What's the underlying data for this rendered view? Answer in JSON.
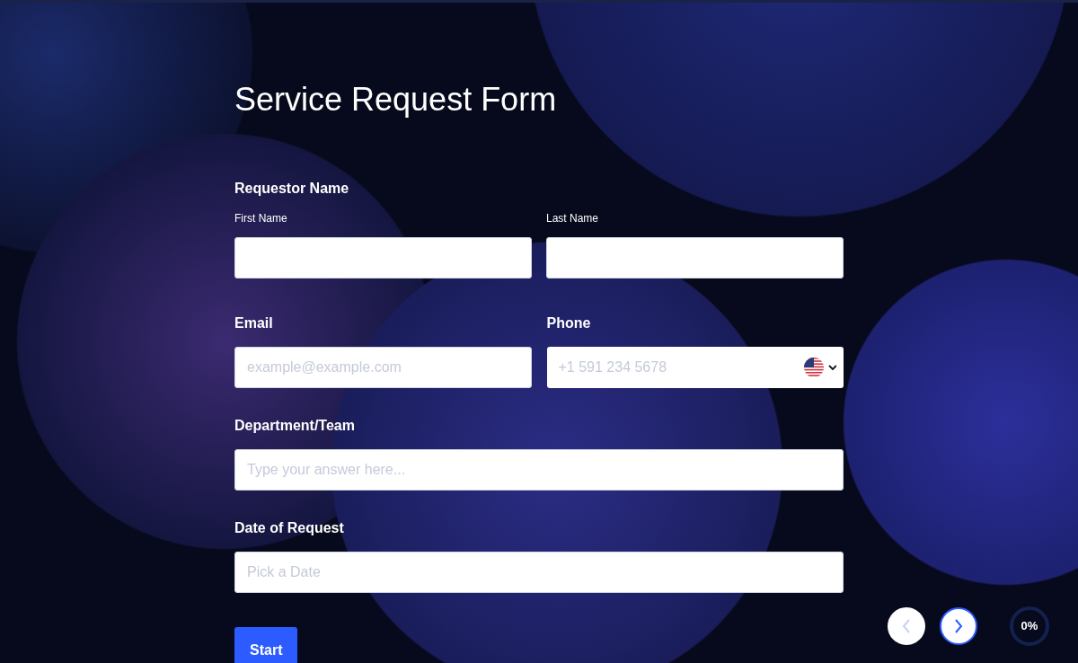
{
  "title": "Service Request Form",
  "sections": [
    {
      "kind": "name",
      "label": "Requestor Name",
      "fields": [
        {
          "sublabel": "First Name"
        },
        {
          "sublabel": "Last Name"
        }
      ]
    },
    {
      "kind": "pair",
      "fields": [
        {
          "label": "Email",
          "placeholder": "example@example.com"
        },
        {
          "label": "Phone",
          "placeholder": "+1 591 234 5678",
          "country_picker": true
        }
      ]
    },
    {
      "kind": "single",
      "label": "Department/Team",
      "placeholder": "Type your answer here..."
    },
    {
      "kind": "single",
      "label": "Date of Request",
      "placeholder": "Pick a Date"
    }
  ],
  "start_button": "Start",
  "navigation": {
    "previous_disabled": true,
    "next_disabled": false
  },
  "progress": {
    "reading": "0%"
  }
}
